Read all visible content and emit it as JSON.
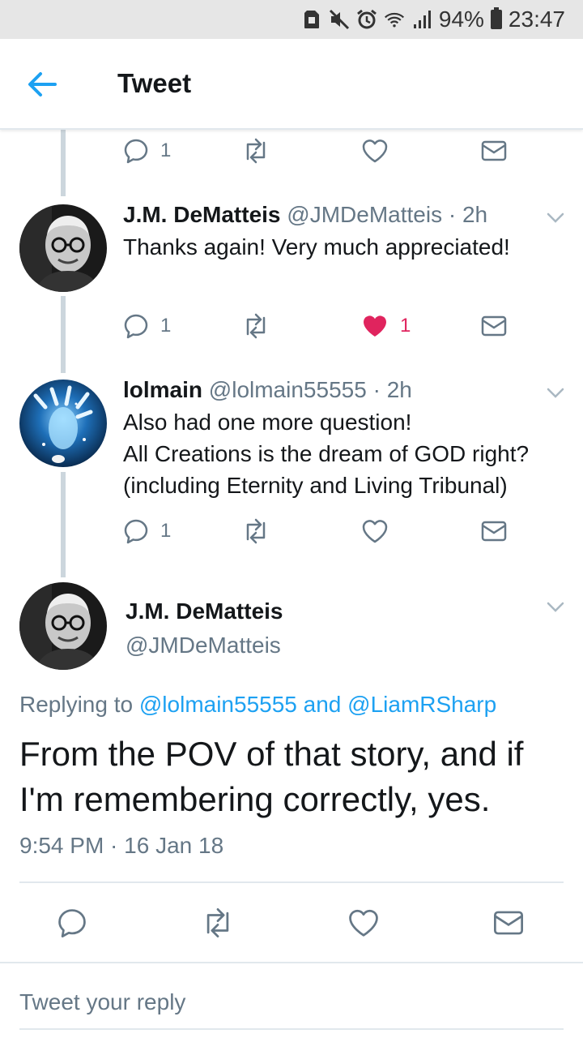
{
  "status_bar": {
    "battery": "94%",
    "time": "23:47",
    "icons": [
      "sd-card-icon",
      "mute-icon",
      "alarm-icon",
      "wifi-icon",
      "signal-icon",
      "battery-icon"
    ]
  },
  "header": {
    "back_icon": "arrow-left-icon",
    "title": "Tweet"
  },
  "colors": {
    "accent": "#1da1f2",
    "like": "#e0245e",
    "muted": "#657786",
    "divider": "#e1e8ed"
  },
  "thread": [
    {
      "actions": {
        "replies": "1",
        "retweets": "",
        "likes": "",
        "liked": false
      }
    },
    {
      "name": "J.M. DeMatteis",
      "handle": "@JMDeMatteis",
      "time": "2h",
      "text": "Thanks again! Very much appreciated!",
      "actions": {
        "replies": "1",
        "retweets": "",
        "likes": "1",
        "liked": true
      }
    },
    {
      "name": "lolmain",
      "handle": "@lolmain55555",
      "time": "2h",
      "text": "Also had one more question!\nAll Creations is the dream of GOD right?\n(including Eternity and Living Tribunal)",
      "actions": {
        "replies": "1",
        "retweets": "",
        "likes": "",
        "liked": false
      }
    }
  ],
  "main_tweet": {
    "name": "J.M. DeMatteis",
    "handle": "@JMDeMatteis",
    "replying_prefix": "Replying to ",
    "mention1": "@lolmain55555",
    "and": " and ",
    "mention2": "@LiamRSharp",
    "text": "From the POV of that story, and if I'm remembering correctly, yes.",
    "timestamp": "9:54 PM · 16 Jan 18"
  },
  "reply": {
    "placeholder": "Tweet your reply"
  }
}
